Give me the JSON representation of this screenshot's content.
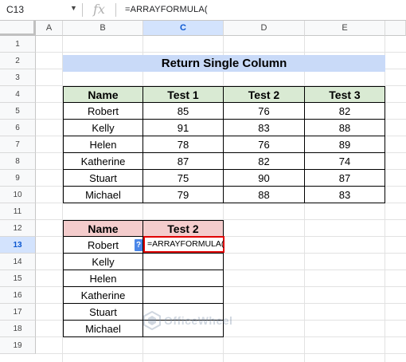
{
  "formula_bar": {
    "name_box": "C13",
    "fx_icon": "fx-icon",
    "formula": "=ARRAYFORMULA("
  },
  "columns": [
    "A",
    "B",
    "C",
    "D",
    "E"
  ],
  "rows": [
    "1",
    "2",
    "3",
    "4",
    "5",
    "6",
    "7",
    "8",
    "9",
    "10",
    "11",
    "12",
    "13",
    "14",
    "15",
    "16",
    "17",
    "18",
    "19"
  ],
  "selected_column": "C",
  "selected_row": "13",
  "title": "Return Single Column",
  "table1": {
    "headers": [
      "Name",
      "Test 1",
      "Test 2",
      "Test 3"
    ],
    "rows": [
      [
        "Robert",
        "85",
        "76",
        "82"
      ],
      [
        "Kelly",
        "91",
        "83",
        "88"
      ],
      [
        "Helen",
        "78",
        "76",
        "89"
      ],
      [
        "Katherine",
        "87",
        "82",
        "74"
      ],
      [
        "Stuart",
        "75",
        "90",
        "87"
      ],
      [
        "Michael",
        "79",
        "88",
        "83"
      ]
    ]
  },
  "table2": {
    "headers": [
      "Name",
      "Test 2"
    ],
    "names": [
      "Robert",
      "Kelly",
      "Helen",
      "Katherine",
      "Stuart",
      "Michael"
    ],
    "active_cell_text": "=ARRAYFORMULA(",
    "help_badge": "?"
  },
  "watermark": "OfficeWheel",
  "colors": {
    "title_bg": "#c9daf8",
    "table1_header_bg": "#d9ead3",
    "table2_header_bg": "#f4cccc",
    "active_border": "#e00000",
    "selection_header": "#d3e3fd"
  }
}
